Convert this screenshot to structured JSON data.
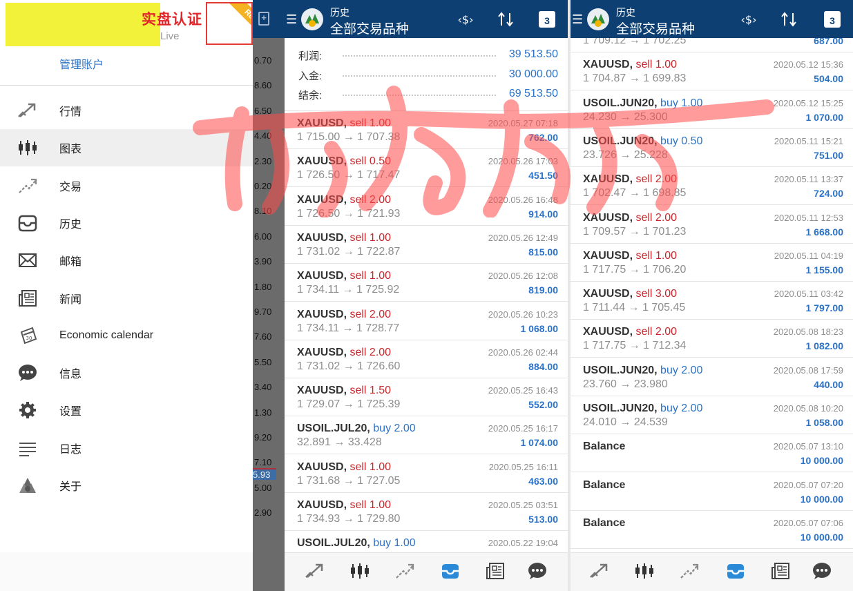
{
  "drawer": {
    "account_title": "实盘认证",
    "account_subtitle": "Live",
    "real_badge": "Real",
    "manage_accounts": "管理账户",
    "items": [
      {
        "label": "行情",
        "icon": "quotes-icon",
        "active": false
      },
      {
        "label": "图表",
        "icon": "chart-icon",
        "active": true
      },
      {
        "label": "交易",
        "icon": "trade-icon",
        "active": false
      },
      {
        "label": "历史",
        "icon": "history-icon",
        "active": false
      },
      {
        "label": "邮箱",
        "icon": "mail-icon",
        "active": false
      },
      {
        "label": "新闻",
        "icon": "news-icon",
        "active": false
      },
      {
        "label": "Economic calendar",
        "icon": "calendar-icon",
        "active": false
      },
      {
        "label": "信息",
        "icon": "chat-icon",
        "active": false
      },
      {
        "label": "设置",
        "icon": "gear-icon",
        "active": false
      },
      {
        "label": "日志",
        "icon": "journal-icon",
        "active": false
      },
      {
        "label": "关于",
        "icon": "about-icon",
        "active": false
      }
    ]
  },
  "background_quotes": [
    "0.70",
    "8.60",
    "6.50",
    "4.40",
    "2.30",
    "0.20",
    "8.10",
    "6.00",
    "3.90",
    "1.80",
    "9.70",
    "7.60",
    "5.50",
    "3.40",
    "1.30",
    "9.20",
    "7.10",
    "5.00",
    "2.90"
  ],
  "background_bid": "5.93",
  "header": {
    "title": "历史",
    "subtitle": "全部交易品种",
    "calendar_day": "3"
  },
  "summary": [
    {
      "label": "利润:",
      "value": "39 513.50"
    },
    {
      "label": "入金:",
      "value": "30 000.00"
    },
    {
      "label": "结余:",
      "value": "69 513.50"
    }
  ],
  "deals_left": [
    {
      "symbol": "XAUUSD,",
      "side": "sell 1.00",
      "type": "sell",
      "prices": "1 715.00 → 1 707.38",
      "time": "2020.05.27 07:18",
      "profit": "762.00"
    },
    {
      "symbol": "XAUUSD,",
      "side": "sell 0.50",
      "type": "sell",
      "prices": "1 726.50 → 1 717.47",
      "time": "2020.05.26 17:03",
      "profit": "451.50"
    },
    {
      "symbol": "XAUUSD,",
      "side": "sell 2.00",
      "type": "sell",
      "prices": "1 726.50 → 1 721.93",
      "time": "2020.05.26 16:48",
      "profit": "914.00"
    },
    {
      "symbol": "XAUUSD,",
      "side": "sell 1.00",
      "type": "sell",
      "prices": "1 731.02 → 1 722.87",
      "time": "2020.05.26 12:49",
      "profit": "815.00"
    },
    {
      "symbol": "XAUUSD,",
      "side": "sell 1.00",
      "type": "sell",
      "prices": "1 734.11 → 1 725.92",
      "time": "2020.05.26 12:08",
      "profit": "819.00"
    },
    {
      "symbol": "XAUUSD,",
      "side": "sell 2.00",
      "type": "sell",
      "prices": "1 734.11 → 1 728.77",
      "time": "2020.05.26 10:23",
      "profit": "1 068.00"
    },
    {
      "symbol": "XAUUSD,",
      "side": "sell 2.00",
      "type": "sell",
      "prices": "1 731.02 → 1 726.60",
      "time": "2020.05.26 02:44",
      "profit": "884.00"
    },
    {
      "symbol": "XAUUSD,",
      "side": "sell 1.50",
      "type": "sell",
      "prices": "1 729.07 → 1 725.39",
      "time": "2020.05.25 16:43",
      "profit": "552.00"
    },
    {
      "symbol": "USOIL.JUL20,",
      "side": "buy 2.00",
      "type": "buy",
      "prices": "32.891 → 33.428",
      "time": "2020.05.25 16:17",
      "profit": "1 074.00"
    },
    {
      "symbol": "XAUUSD,",
      "side": "sell 1.00",
      "type": "sell",
      "prices": "1 731.68 → 1 727.05",
      "time": "2020.05.25 16:11",
      "profit": "463.00"
    },
    {
      "symbol": "XAUUSD,",
      "side": "sell 1.00",
      "type": "sell",
      "prices": "1 734.93 → 1 729.80",
      "time": "2020.05.25 03:51",
      "profit": "513.00"
    },
    {
      "symbol": "USOIL.JUL20,",
      "side": "buy 1.00",
      "type": "buy",
      "prices": "",
      "time": "2020.05.22 19:04",
      "profit": ""
    }
  ],
  "deals_right": [
    {
      "symbol": "",
      "side": "",
      "type": "sell",
      "prices": "1 709.12 → 1 702.25",
      "time": "",
      "profit": "687.00"
    },
    {
      "symbol": "XAUUSD,",
      "side": "sell 1.00",
      "type": "sell",
      "prices": "1 704.87 → 1 699.83",
      "time": "2020.05.12 15:36",
      "profit": "504.00"
    },
    {
      "symbol": "USOIL.JUN20,",
      "side": "buy 1.00",
      "type": "buy",
      "prices": "24.230 → 25.300",
      "time": "2020.05.12 15:25",
      "profit": "1 070.00"
    },
    {
      "symbol": "USOIL.JUN20,",
      "side": "buy 0.50",
      "type": "buy",
      "prices": "23.726 → 25.228",
      "time": "2020.05.11 15:21",
      "profit": "751.00"
    },
    {
      "symbol": "XAUUSD,",
      "side": "sell 2.00",
      "type": "sell",
      "prices": "1 702.47 → 1 698.85",
      "time": "2020.05.11 13:37",
      "profit": "724.00"
    },
    {
      "symbol": "XAUUSD,",
      "side": "sell 2.00",
      "type": "sell",
      "prices": "1 709.57 → 1 701.23",
      "time": "2020.05.11 12:53",
      "profit": "1 668.00"
    },
    {
      "symbol": "XAUUSD,",
      "side": "sell 1.00",
      "type": "sell",
      "prices": "1 717.75 → 1 706.20",
      "time": "2020.05.11 04:19",
      "profit": "1 155.00"
    },
    {
      "symbol": "XAUUSD,",
      "side": "sell 3.00",
      "type": "sell",
      "prices": "1 711.44 → 1 705.45",
      "time": "2020.05.11 03:42",
      "profit": "1 797.00"
    },
    {
      "symbol": "XAUUSD,",
      "side": "sell 2.00",
      "type": "sell",
      "prices": "1 717.75 → 1 712.34",
      "time": "2020.05.08 18:23",
      "profit": "1 082.00"
    },
    {
      "symbol": "USOIL.JUN20,",
      "side": "buy 2.00",
      "type": "buy",
      "prices": "23.760 → 23.980",
      "time": "2020.05.08 17:59",
      "profit": "440.00"
    },
    {
      "symbol": "USOIL.JUN20,",
      "side": "buy 2.00",
      "type": "buy",
      "prices": "24.010 → 24.539",
      "time": "2020.05.08 10:20",
      "profit": "1 058.00"
    },
    {
      "symbol": "Balance",
      "side": "",
      "type": "balance",
      "prices": "",
      "time": "2020.05.07 13:10",
      "profit": "10 000.00"
    },
    {
      "symbol": "Balance",
      "side": "",
      "type": "balance",
      "prices": "",
      "time": "2020.05.07 07:20",
      "profit": "10 000.00"
    },
    {
      "symbol": "Balance",
      "side": "",
      "type": "balance",
      "prices": "",
      "time": "2020.05.07 07:06",
      "profit": "10 000.00"
    }
  ],
  "tabs": [
    {
      "name": "tab-quotes",
      "icon": "quotes-icon"
    },
    {
      "name": "tab-chart",
      "icon": "chart-icon"
    },
    {
      "name": "tab-trade",
      "icon": "trade-icon"
    },
    {
      "name": "tab-history",
      "icon": "history-icon",
      "active": true
    },
    {
      "name": "tab-news",
      "icon": "news-icon"
    },
    {
      "name": "tab-chat",
      "icon": "chat-icon"
    }
  ],
  "colors": {
    "appbar": "#0d3f73",
    "accent": "#2a72c8",
    "sell": "#c8262b",
    "active_tab": "#2b8ad8",
    "watermark": "#ff4b4b"
  }
}
